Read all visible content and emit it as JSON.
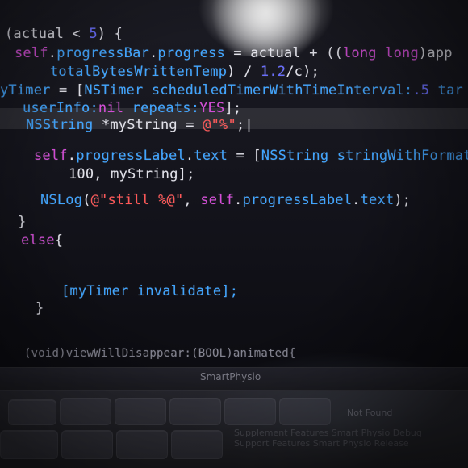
{
  "editor": {
    "lines": [
      {
        "segments": [
          {
            "t": "(actual < ",
            "c": "plain"
          },
          {
            "t": "5",
            "c": "num"
          },
          {
            "t": ") {",
            "c": "plain"
          }
        ]
      },
      {
        "segments": [
          {
            "t": "self",
            "c": "kw"
          },
          {
            "t": ".",
            "c": "plain"
          },
          {
            "t": "progressBar",
            "c": "ty"
          },
          {
            "t": ".",
            "c": "plain"
          },
          {
            "t": "progress",
            "c": "ty"
          },
          {
            "t": " = actual + ((",
            "c": "plain"
          },
          {
            "t": "long long",
            "c": "kw"
          },
          {
            "t": ")app",
            "c": "plain"
          }
        ]
      },
      {
        "segments": [
          {
            "t": "totalBytesWrittenTemp",
            "c": "ty"
          },
          {
            "t": ") / ",
            "c": "plain"
          },
          {
            "t": "1.2",
            "c": "num"
          },
          {
            "t": "/c);",
            "c": "plain"
          }
        ]
      },
      {
        "segments": [
          {
            "t": "yTimer",
            "c": "ty"
          },
          {
            "t": " = [",
            "c": "plain"
          },
          {
            "t": "NSTimer",
            "c": "ty"
          },
          {
            "t": " scheduledTimerWithTimeInterval:",
            "c": "ty"
          },
          {
            "t": ".5",
            "c": "num"
          },
          {
            "t": " tar",
            "c": "ty"
          }
        ]
      },
      {
        "segments": [
          {
            "t": "userInfo:",
            "c": "ty"
          },
          {
            "t": "nil",
            "c": "kw"
          },
          {
            "t": " repeats:",
            "c": "ty"
          },
          {
            "t": "YES",
            "c": "kw"
          },
          {
            "t": "];",
            "c": "plain"
          }
        ]
      },
      {
        "segments": [
          {
            "t": "NSString",
            "c": "ty"
          },
          {
            "t": " *myString = ",
            "c": "plain"
          },
          {
            "t": "@\"%\"",
            "c": "str"
          },
          {
            "t": ";|",
            "c": "plain"
          }
        ]
      },
      {
        "segments": [
          {
            "t": "self",
            "c": "kw"
          },
          {
            "t": ".",
            "c": "plain"
          },
          {
            "t": "progressLabel",
            "c": "ty"
          },
          {
            "t": ".",
            "c": "plain"
          },
          {
            "t": "text",
            "c": "ty"
          },
          {
            "t": " = [",
            "c": "plain"
          },
          {
            "t": "NSString",
            "c": "ty"
          },
          {
            "t": " stringWithFormat:",
            "c": "ty"
          },
          {
            "t": "@",
            "c": "str"
          }
        ]
      },
      {
        "segments": [
          {
            "t": "100, myString];",
            "c": "plain"
          }
        ]
      },
      {
        "segments": [
          {
            "t": "NSLog",
            "c": "ty"
          },
          {
            "t": "(",
            "c": "plain"
          },
          {
            "t": "@\"still %@\"",
            "c": "str"
          },
          {
            "t": ", ",
            "c": "plain"
          },
          {
            "t": "self",
            "c": "kw"
          },
          {
            "t": ".",
            "c": "plain"
          },
          {
            "t": "progressLabel",
            "c": "ty"
          },
          {
            "t": ".",
            "c": "plain"
          },
          {
            "t": "text",
            "c": "ty"
          },
          {
            "t": ");",
            "c": "plain"
          }
        ]
      },
      {
        "segments": [
          {
            "t": "}",
            "c": "plain"
          }
        ]
      },
      {
        "segments": [
          {
            "t": "else",
            "c": "kw"
          },
          {
            "t": "{",
            "c": "plain"
          }
        ]
      },
      {
        "segments": [
          {
            "t": "[myTimer invalidate];",
            "c": "ty"
          }
        ]
      },
      {
        "segments": [
          {
            "t": "}",
            "c": "plain"
          }
        ]
      },
      {
        "segments": [
          {
            "t": "(void)viewWillDisappear:(BOOL)animated{",
            "c": "muted"
          }
        ]
      }
    ],
    "colors": {
      "keyword": "#d34fd6",
      "type": "#45a7ff",
      "string": "#ff5a5a",
      "number": "#6c70ff",
      "plain": "#e6e6ee"
    }
  },
  "dock": {
    "label": "SmartPhysio"
  },
  "overlays": {
    "right": "Not Found",
    "bottom_1": "Supplement Features Smart Physio Debug",
    "bottom_2": "Support Features Smart Physio Release"
  }
}
